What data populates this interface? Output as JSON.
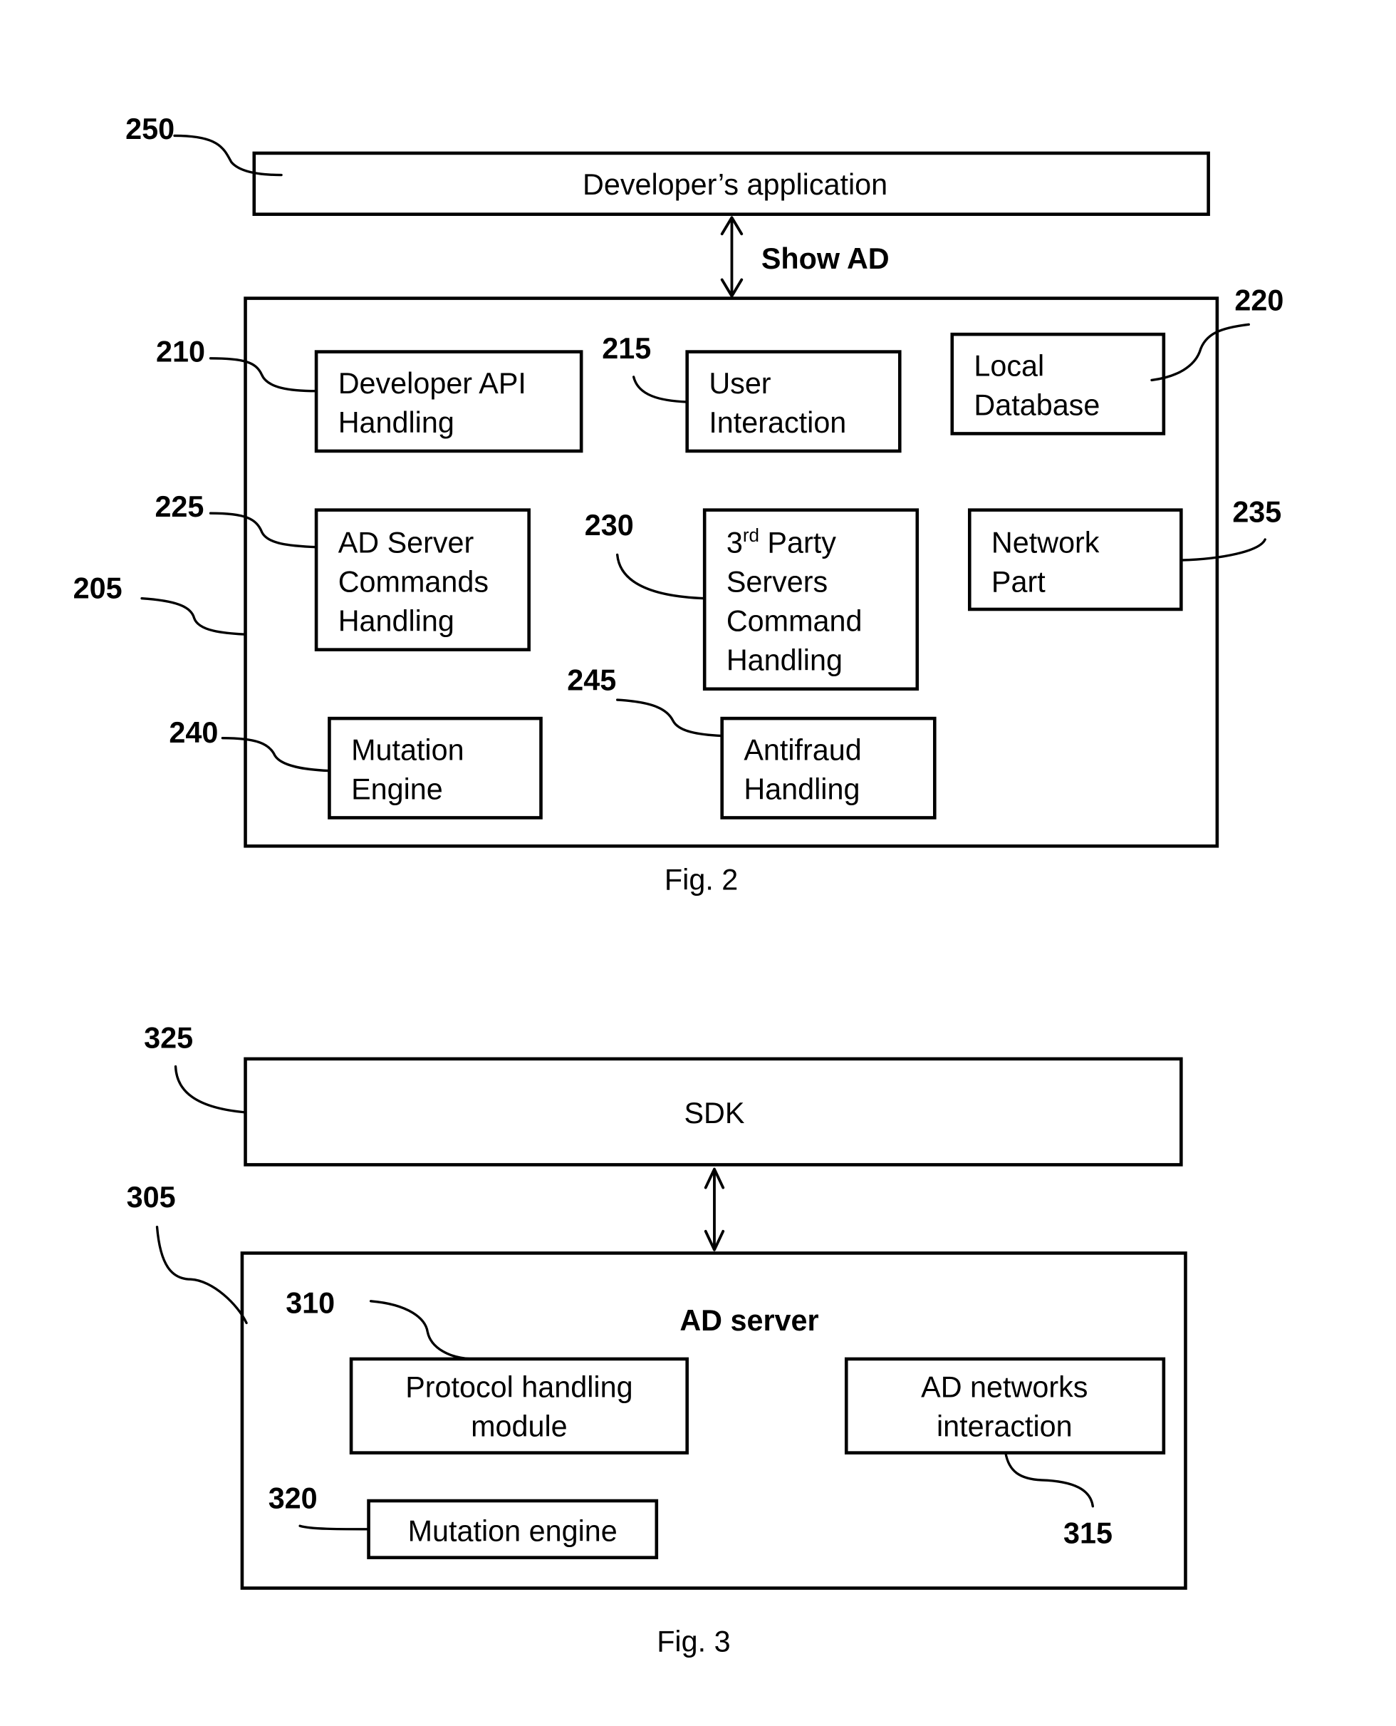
{
  "fig2": {
    "caption": "Fig. 2",
    "developer_app": {
      "ref": "250",
      "label": "Developer’s application"
    },
    "link_label": "Show AD",
    "sdk": {
      "ref": "205"
    },
    "modules": [
      {
        "ref": "210",
        "lines": [
          "Developer API",
          "Handling"
        ]
      },
      {
        "ref": "215",
        "lines": [
          "User",
          "Interaction"
        ]
      },
      {
        "ref": "220",
        "lines": [
          "Local",
          "Database"
        ]
      },
      {
        "ref": "225",
        "lines": [
          "AD Server",
          "Commands",
          "Handling"
        ]
      },
      {
        "ref": "230",
        "first_num": "3",
        "first_sup": "rd",
        "first_rest": " Party",
        "lines": [
          "Servers",
          "Command",
          "Handling"
        ]
      },
      {
        "ref": "235",
        "lines": [
          "Network",
          "Part"
        ]
      },
      {
        "ref": "240",
        "lines": [
          "Mutation",
          "Engine"
        ]
      },
      {
        "ref": "245",
        "lines": [
          "Antifraud",
          "Handling"
        ]
      }
    ]
  },
  "fig3": {
    "caption": "Fig. 3",
    "sdk": {
      "ref": "325",
      "label": "SDK"
    },
    "ad_server": {
      "ref": "305",
      "label": "AD server"
    },
    "modules": [
      {
        "ref": "310",
        "lines": [
          "Protocol handling",
          "module"
        ]
      },
      {
        "ref": "315",
        "lines": [
          "AD networks",
          "interaction"
        ]
      },
      {
        "ref": "320",
        "lines": [
          "Mutation engine"
        ]
      }
    ]
  }
}
